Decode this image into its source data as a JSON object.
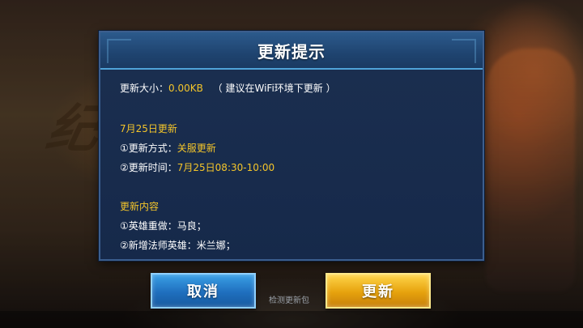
{
  "dialog": {
    "title": "更新提示",
    "size_label": "更新大小：",
    "size_value": "0.00KB",
    "size_note": "（ 建议在WiFi环境下更新 ）",
    "schedule_title": "7月25日更新",
    "method_label": "①更新方式：",
    "method_value": "关服更新",
    "time_label": "②更新时间：",
    "time_value": "7月25日08:30-10:00",
    "content_title": "更新内容",
    "content_items": [
      "①英雄重做：马良；",
      "②新增法师英雄：米兰娜；"
    ]
  },
  "buttons": {
    "cancel_label": "取消",
    "update_label": "更新"
  },
  "check_link": "检测更新包",
  "colors": {
    "highlight": "#f4c52a",
    "dialog_bg": "#1b2f50",
    "header_border": "#4fa3d8",
    "cancel_button": "#1f6fbe",
    "update_button": "#e6a20d"
  }
}
